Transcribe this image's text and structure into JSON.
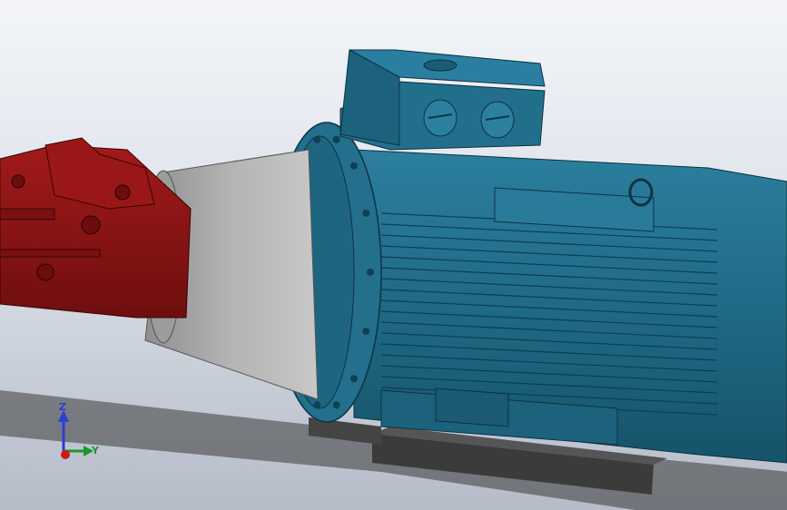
{
  "viewport": {
    "background_top": "#f3f5f8",
    "background_bottom": "#b5bcc8"
  },
  "model": {
    "parts": [
      {
        "name": "hydraulic-pump",
        "color": "#8e1414"
      },
      {
        "name": "bell-housing-adapter",
        "color": "#a8a8a8"
      },
      {
        "name": "electric-motor",
        "color": "#1f6a86"
      },
      {
        "name": "motor-terminal-box",
        "color": "#226f8c"
      },
      {
        "name": "motor-base-block",
        "color": "#3b3b3b"
      }
    ]
  },
  "triad": {
    "z_label": "Z",
    "y_label": "Y",
    "z_color": "#2a3fd4",
    "y_color": "#1a9a2a",
    "x_color": "#d01818"
  }
}
